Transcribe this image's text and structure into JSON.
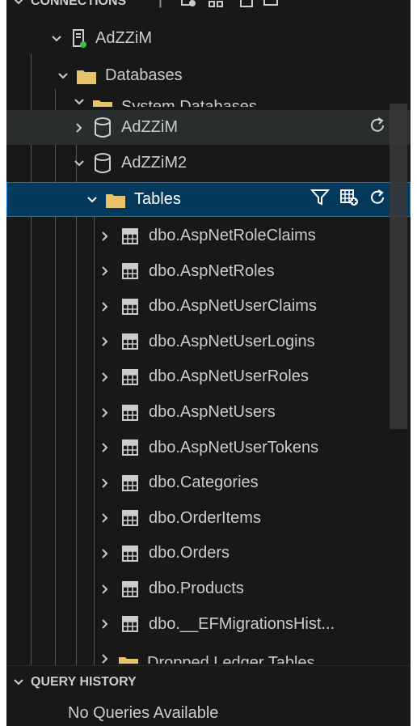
{
  "connections_header": {
    "label": "CONNECTIONS",
    "divider": "|"
  },
  "tree": {
    "server": {
      "label": "AdZZiM",
      "icon": "server-connected-icon"
    },
    "databases_folder": {
      "label": "Databases",
      "icon": "folder-icon"
    },
    "system_databases": {
      "label": "System Databases",
      "icon": "folder-icon"
    },
    "db1": {
      "label": "AdZZiM",
      "icon": "database-icon",
      "action": "refresh-icon"
    },
    "db2": {
      "label": "AdZZiM2",
      "icon": "database-icon"
    },
    "tables_folder": {
      "label": "Tables",
      "icon": "folder-icon",
      "actions": [
        "filter-icon",
        "new-table-icon",
        "refresh-icon"
      ]
    },
    "tables": [
      "dbo.AspNetRoleClaims",
      "dbo.AspNetRoles",
      "dbo.AspNetUserClaims",
      "dbo.AspNetUserLogins",
      "dbo.AspNetUserRoles",
      "dbo.AspNetUsers",
      "dbo.AspNetUserTokens",
      "dbo.Categories",
      "dbo.OrderItems",
      "dbo.Orders",
      "dbo.Products",
      "dbo.__EFMigrationsHist..."
    ],
    "dropped_ledger": {
      "label": "Dropped Ledger Tables",
      "icon": "folder-icon"
    }
  },
  "query_history": {
    "title": "QUERY HISTORY",
    "empty_text": "No Queries Available"
  },
  "colors": {
    "background": "#181818",
    "selected": "#04395e",
    "selected_border": "#0078d4",
    "folder": "#e8c26a",
    "connected_dot": "#3fb950"
  }
}
